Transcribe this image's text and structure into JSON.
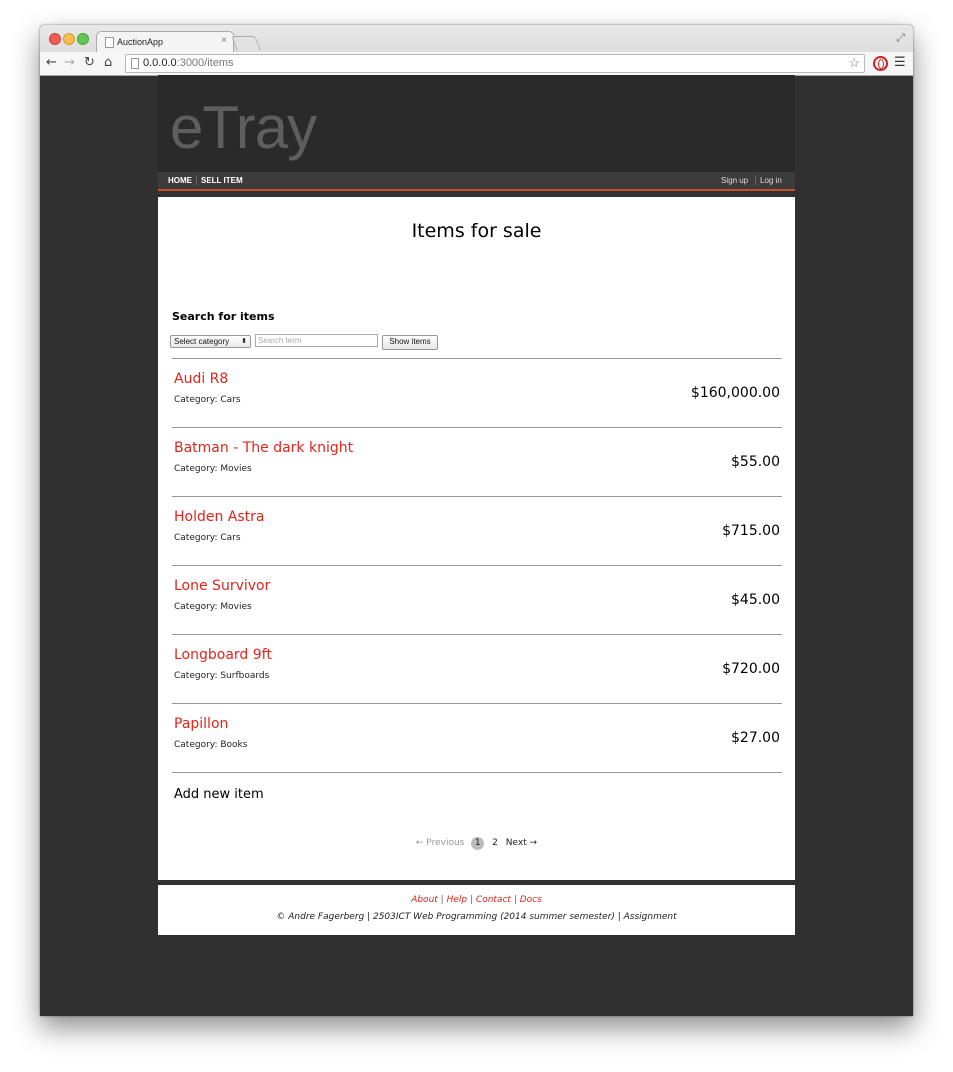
{
  "browser": {
    "tab_title": "AuctionApp",
    "tab_close": "×",
    "url_host": "0.0.0.0",
    "url_path": ":3000/items"
  },
  "site": {
    "logo": "eTray",
    "nav": {
      "home": "HOME",
      "sell": "SELL ITEM",
      "signup": "Sign up",
      "login": "Log in"
    },
    "accent_color": "#e0251b",
    "menu_border_color": "#c4502b"
  },
  "main": {
    "title": "Items for sale",
    "search": {
      "heading": "Search for items",
      "category_select": "Select category",
      "term_placeholder": "Search term",
      "button": "Show items"
    },
    "items": [
      {
        "title": "Audi R8",
        "category": "Category: Cars",
        "price": "$160,000.00"
      },
      {
        "title": "Batman - The dark knight",
        "category": "Category: Movies",
        "price": "$55.00"
      },
      {
        "title": "Holden Astra",
        "category": "Category: Cars",
        "price": "$715.00"
      },
      {
        "title": "Lone Survivor",
        "category": "Category: Movies",
        "price": "$45.00"
      },
      {
        "title": "Longboard 9ft",
        "category": "Category: Surfboards",
        "price": "$720.00"
      },
      {
        "title": "Papillon",
        "category": "Category: Books",
        "price": "$27.00"
      }
    ],
    "add_item": "Add new item",
    "pagination": {
      "prev": "← Previous",
      "current": "1",
      "page2": "2",
      "next": "Next →"
    }
  },
  "footer": {
    "links": [
      "About",
      "Help",
      "Contact",
      "Docs"
    ],
    "separator": "|",
    "credit": "© Andre Fagerberg | 2503ICT Web Programming (2014 summer semester) | Assignment"
  }
}
